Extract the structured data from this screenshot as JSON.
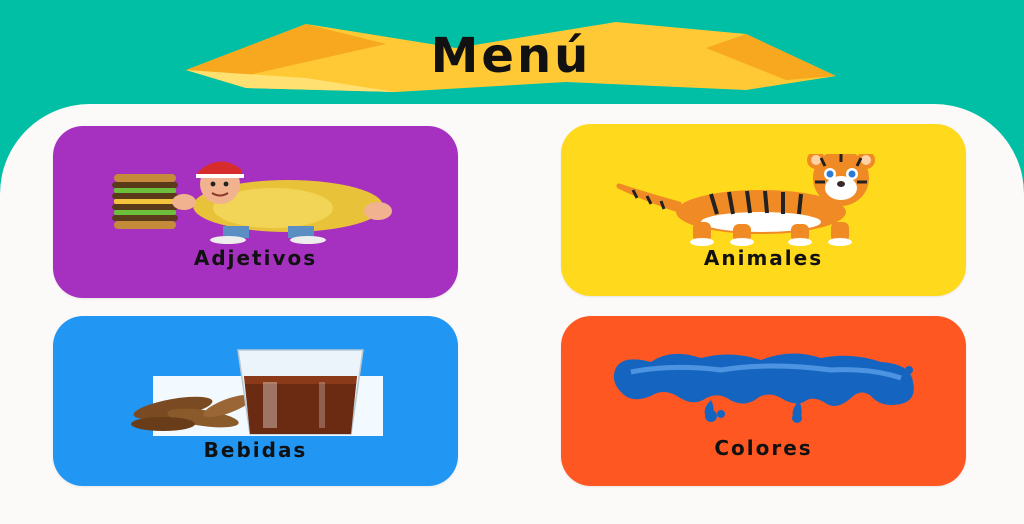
{
  "header": {
    "title": "Menú",
    "bg_color": "#00BFA5",
    "banner_color": "#FFC936"
  },
  "menu": {
    "items": [
      {
        "label": "Adjetivos",
        "color": "#A631C0",
        "icon": "chubby-chef-with-burger-icon"
      },
      {
        "label": "Animales",
        "color": "#FFD91C",
        "icon": "tiger-icon"
      },
      {
        "label": "Bebidas",
        "color": "#2196F3",
        "icon": "glass-of-drink-icon"
      },
      {
        "label": "Colores",
        "color": "#FF5722",
        "icon": "blue-paint-splash-icon"
      }
    ]
  }
}
